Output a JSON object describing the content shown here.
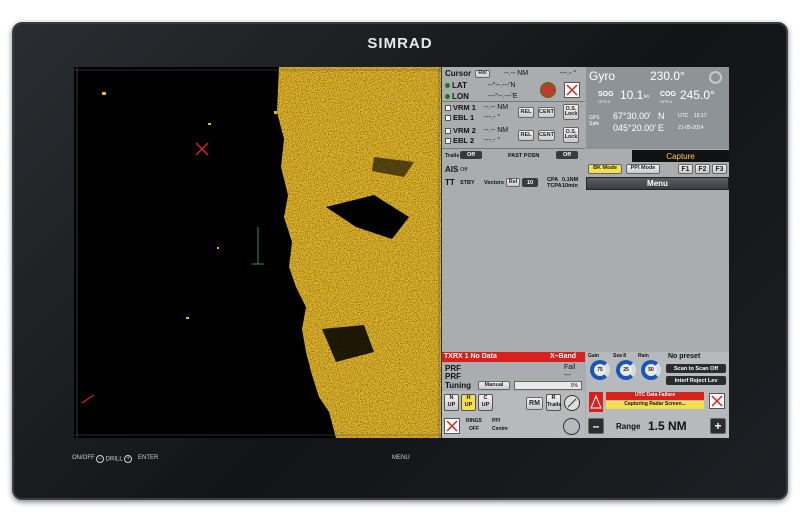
{
  "brand": "SIMRAD",
  "cursor": {
    "label": "Cursor",
    "mode": "Rel",
    "nm": "--.-- NM",
    "deg": "---.- °",
    "lat_label": "LAT",
    "lat_value": "--°--.---'N",
    "lon_label": "LON",
    "lon_value": "---°--.---'E"
  },
  "vrm1": {
    "label": "VRM 1",
    "value": "--.-- NM"
  },
  "ebl1": {
    "label": "EBL 1",
    "value": "---.- °"
  },
  "vrm2": {
    "label": "VRM 2",
    "value": "--.-- NM"
  },
  "ebl2": {
    "label": "EBL 2",
    "value": "---.- °"
  },
  "rel_btn": "REL",
  "cent_btn": "CENT",
  "os_lock": "O.S. Lock",
  "trails": {
    "label": "Trails",
    "value": "Off",
    "past_label": "PAST POSN",
    "past_value": "Off"
  },
  "ais": {
    "label": "AIS",
    "value": "Off"
  },
  "tt": {
    "label": "TT",
    "stby": "STBY",
    "vectors_label": "Vectors",
    "vectors_value": "Rel",
    "vec_min": "10",
    "cpa_label": "CPA",
    "cpa_value": "0.1NM",
    "tcpa_label": "TCPA",
    "tcpa_value": "10min"
  },
  "gyro": {
    "label": "Gyro",
    "value": "230.0°",
    "sog_label": "SOG",
    "sog_src": "GPS A",
    "sog_value": "10.1",
    "sog_unit": "kn",
    "cog_label": "COG",
    "cog_src": "GPS A",
    "cog_value": "245.0°",
    "gps_label": "GPS Safe",
    "lat": "67°30.00'",
    "lat_hemi": "N",
    "lon": "045°20.00'",
    "lon_hemi": "E",
    "utc_label": "UTC",
    "time": "16:17",
    "date": "21-05-2014"
  },
  "capture": "Capture",
  "bk_mode": "BK Mode",
  "ppi_mode": "PPI Mode",
  "f1": "F1",
  "f2": "F2",
  "f3": "F3",
  "menu": "Menu",
  "txrx": {
    "label": "TXRX 1 No Data",
    "band": "X–Band"
  },
  "prf": {
    "label1": "PRF",
    "value1": "Fail",
    "label2": "PRF",
    "value2": "---"
  },
  "tuning": {
    "label": "Tuning",
    "mode": "Manual",
    "value": "0%"
  },
  "gain": {
    "label": "Gain",
    "value": "75"
  },
  "sea": {
    "label": "Sea 8",
    "value": "25"
  },
  "rain": {
    "label": "Rain",
    "value": "50"
  },
  "preset": "No preset",
  "scan": "Scan to Scan Off",
  "interf": "Interf Reject Lev",
  "alerts": {
    "a1": "UTC Data Failure",
    "a2": "Capturing Radar Screen..."
  },
  "nup": {
    "top": "N",
    "bot": "UP"
  },
  "hup": {
    "top": "H",
    "bot": "UP"
  },
  "cup": {
    "top": "C",
    "bot": "UP"
  },
  "rm": "RM",
  "rtrails": {
    "top": "R",
    "bot": "Trails"
  },
  "rings": {
    "label": "RINGS",
    "value": "OFF"
  },
  "ppi": {
    "label": "PPI",
    "value": "Centre"
  },
  "range": {
    "label": "Range",
    "value": "1.5 NM",
    "minus": "–",
    "plus": "+"
  },
  "controls": {
    "onoff": "ON/OFF",
    "drill": "DRILL",
    "enter": "ENTER",
    "menu": "MENU"
  },
  "colors": {
    "echo": "#e5b82a",
    "alert": "#d8211d",
    "panel": "#a9adb0",
    "gauge": "#1a56b8"
  }
}
